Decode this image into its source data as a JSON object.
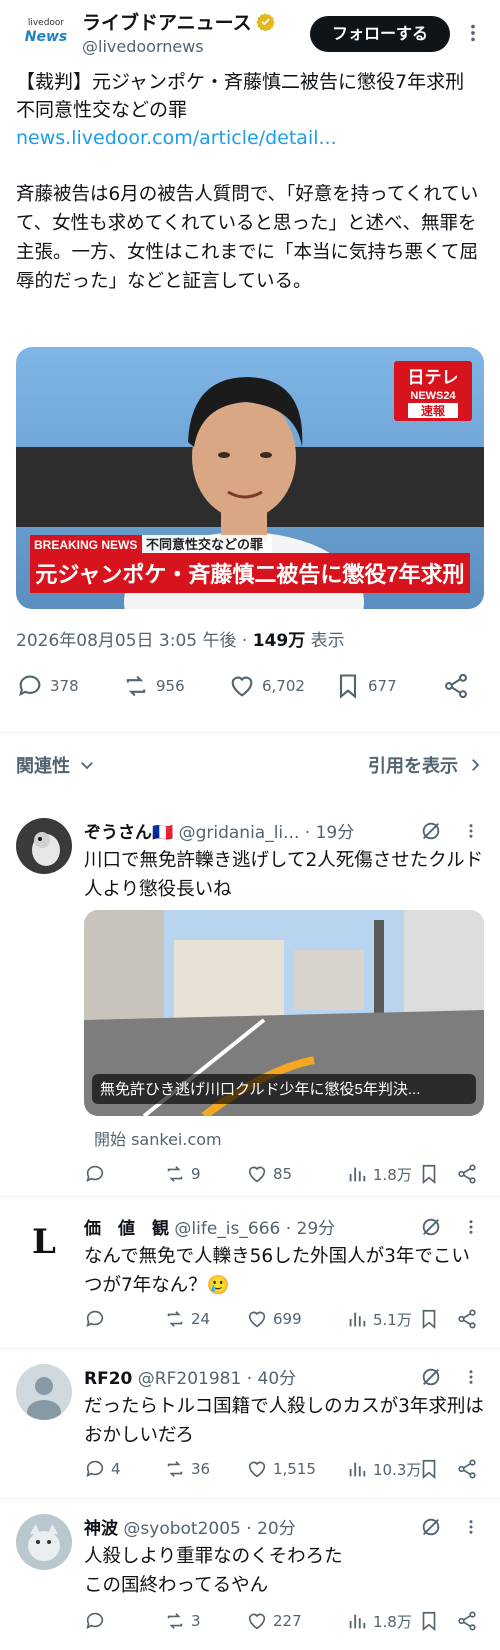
{
  "post": {
    "logo_top": "livedoor",
    "logo_bottom": "News",
    "author_name": "ライブドアニュース",
    "author_handle": "@livedoornews",
    "follow_label": "フォローする",
    "headline": "【裁判】元ジャンポケ・斉藤慎二被告に懲役7年求刑 不同意性交などの罪",
    "link": "news.livedoor.com/article/detail...",
    "body": "斉藤被告は6月の被告人質問で、「好意を持ってくれていて、女性も求めてくれていると思った」と述べ、無罪を主張。一方、女性はこれまでに「本当に気持ち悪くて屈辱的だった」などと証言している。",
    "image": {
      "logo_top": "日テレ",
      "logo_mid": "NEWS24",
      "logo_bottom": "速報",
      "breaking": "BREAKING NEWS",
      "subcaption": "不同意性交などの罪",
      "caption": "元ジャンポケ・斉藤慎二被告に懲役7年求刑"
    },
    "datetime": "2026年08月05日 3:05 午後",
    "views": "149万",
    "views_label": "表示",
    "stats": {
      "replies": "378",
      "reposts": "956",
      "likes": "6,702",
      "bookmarks": "677"
    }
  },
  "sort": {
    "relevance": "関連性",
    "quotes": "引用を表示"
  },
  "replies": [
    {
      "name": "ぞうさん🇫🇷",
      "handle": "@gridania_li...",
      "time": "19分",
      "text": "川口で無免許轢き逃げして2人死傷させたクルド人より懲役長いね",
      "quote": {
        "caption": "無免許ひき逃げ川口クルド少年に懲役5年判決...",
        "source": "開始 sankei.com"
      },
      "stats": {
        "replies": "",
        "reposts": "9",
        "likes": "85",
        "views": "1.8万"
      }
    },
    {
      "name": "価　値　観",
      "handle": "@life_is_666",
      "time": "29分",
      "avatar_letter": "L",
      "text": "なんで無免で人轢き56した外国人が3年でこいつが7年なん？🥲",
      "stats": {
        "replies": "",
        "reposts": "24",
        "likes": "699",
        "views": "5.1万"
      }
    },
    {
      "name": "RF20",
      "handle": "@RF201981",
      "time": "40分",
      "text": "だったらトルコ国籍で人殺しのカスが3年求刑はおかしいだろ",
      "stats": {
        "replies": "4",
        "reposts": "36",
        "likes": "1,515",
        "views": "10.3万"
      }
    },
    {
      "name": "神波",
      "handle": "@syobot2005",
      "time": "20分",
      "text": "人殺しより重罪なのくそわろた\nこの国終わってるやん",
      "stats": {
        "replies": "",
        "reposts": "3",
        "likes": "227",
        "views": "1.8万"
      }
    }
  ],
  "colors": {
    "link": "#1d9bf0",
    "muted": "#536471",
    "text": "#0f1419",
    "breaking_red": "#d7141e"
  }
}
